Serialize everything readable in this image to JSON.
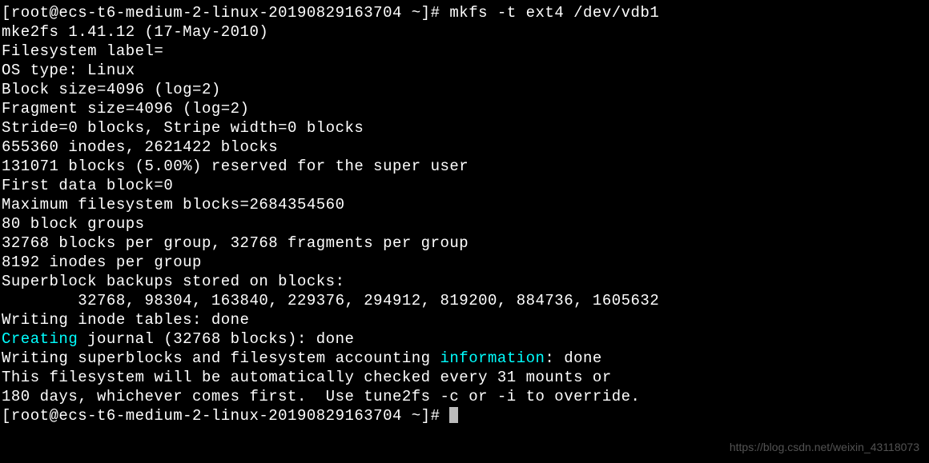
{
  "terminal": {
    "prompt1_user": "[root@ecs-t6-medium-2-linux-20190829163704 ~]#",
    "command1": " mkfs -t ext4 /dev/vdb1",
    "line_mke2fs": "mke2fs 1.41.12 (17-May-2010)",
    "line_fslabel": "Filesystem label=",
    "line_ostype": "OS type: Linux",
    "line_blocksize": "Block size=4096 (log=2)",
    "line_fragsize": "Fragment size=4096 (log=2)",
    "line_stride": "Stride=0 blocks, Stripe width=0 blocks",
    "line_inodes": "655360 inodes, 2621422 blocks",
    "line_reserved": "131071 blocks (5.00%) reserved for the super user",
    "line_firstdata": "First data block=0",
    "line_maxfs": "Maximum filesystem blocks=2684354560",
    "line_bgroups": "80 block groups",
    "line_bpg": "32768 blocks per group, 32768 fragments per group",
    "line_ipg": "8192 inodes per group",
    "line_superblock": "Superblock backups stored on blocks: ",
    "line_sbvalues": "        32768, 98304, 163840, 229376, 294912, 819200, 884736, 1605632",
    "line_blank1": "",
    "line_inodetables": "Writing inode tables: done",
    "line_creating_word": "Creating",
    "line_creating_rest": " journal (32768 blocks): done",
    "line_writing_sb_pre": "Writing superblocks and filesystem accounting ",
    "line_information_word": "information",
    "line_writing_sb_post": ": done",
    "line_blank2": "",
    "line_autocheck1": "This filesystem will be automatically checked every 31 mounts or",
    "line_autocheck2": "180 days, whichever comes first.  Use tune2fs -c or -i to override.",
    "prompt2_user": "[root@ecs-t6-medium-2-linux-20190829163704 ~]#",
    "prompt2_space": " "
  },
  "watermark": "https://blog.csdn.net/weixin_43118073"
}
